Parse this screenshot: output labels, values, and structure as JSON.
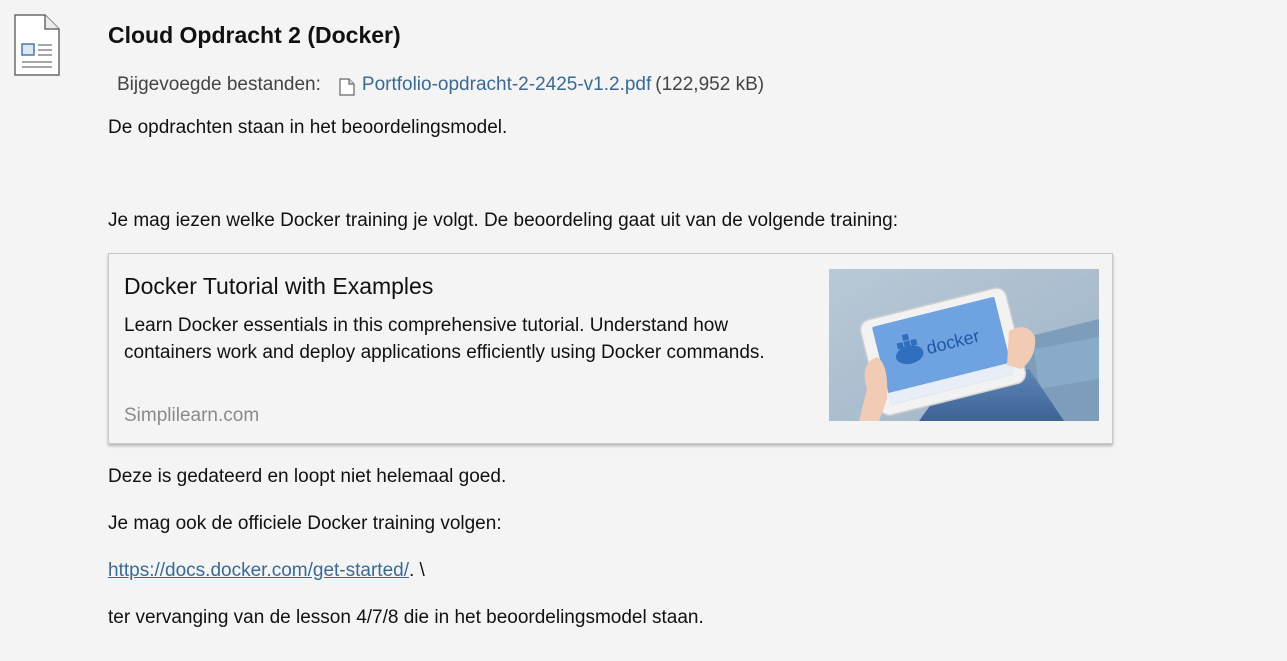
{
  "assignment": {
    "title": "Cloud Opdracht 2 (Docker)",
    "attachments_label": "Bijgevoegde bestanden:",
    "file_name": "Portfolio-opdracht-2-2425-v1.2.pdf",
    "file_size": "(122,952 kB)"
  },
  "body": {
    "p1": "De opdrachten staan in het beoordelingsmodel.",
    "p2": "Je mag iezen welke Docker training je volgt. De beoordeling gaat uit van de volgende training:",
    "p3": "Deze is gedateerd en loopt niet helemaal goed.",
    "p4": "Je mag ook de officiele Docker training volgen:",
    "link_text": "https://docs.docker.com/get-started/",
    "link_suffix": ". \\",
    "p6": "ter vervanging van de lesson 4/7/8 die in het beoordelingsmodel staan."
  },
  "link_card": {
    "title": "Docker Tutorial with Examples",
    "description": "Learn Docker essentials in this comprehensive tutorial. Understand how containers work and deploy applications efficiently using Docker commands.",
    "source": "Simplilearn.com",
    "thumbnail_text": "docker"
  },
  "icons": {
    "assignment": "assignment-document-icon",
    "file": "pdf-file-icon"
  },
  "colors": {
    "background": "#f4f4f4",
    "link": "#3a6a93",
    "muted": "#8a8a8a"
  }
}
